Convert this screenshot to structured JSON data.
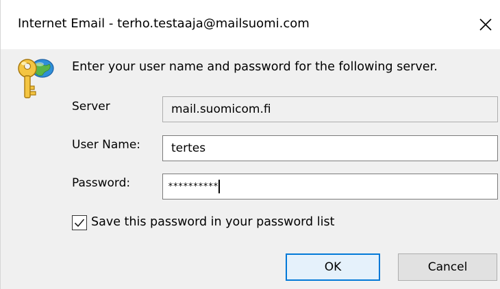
{
  "window": {
    "title": "Internet Email - terho.testaaja@mailsuomi.com",
    "close_icon": "close-icon"
  },
  "dialog": {
    "icon": "key-globe-icon",
    "prompt": "Enter your user name and password for the following server.",
    "server": {
      "label": "Server",
      "value": "mail.suomicom.fi"
    },
    "username": {
      "label": "User Name:",
      "value": "tertes"
    },
    "password": {
      "label": "Password:",
      "value": "**********"
    },
    "save_password": {
      "label": "Save this password in your password list",
      "checked": true
    },
    "buttons": {
      "ok": "OK",
      "cancel": "Cancel"
    }
  },
  "colors": {
    "accent": "#0078d7",
    "dialog_bg": "#f0f0f0",
    "titlebar_bg": "#ffffff"
  }
}
